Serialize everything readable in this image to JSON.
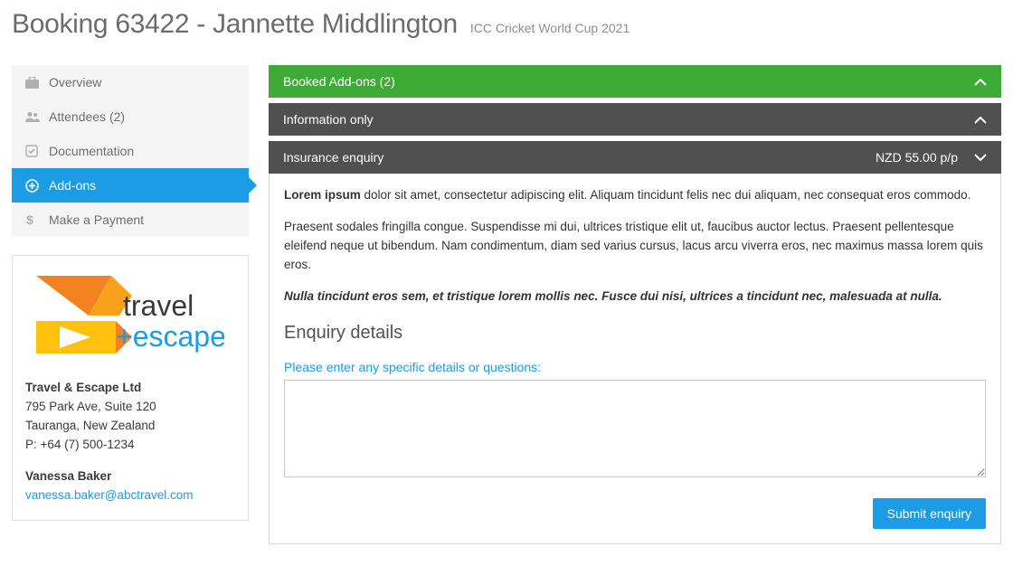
{
  "header": {
    "title": "Booking 63422 - Jannette Middlington",
    "subtitle": "ICC Cricket World Cup 2021"
  },
  "nav": {
    "items": [
      {
        "label": "Overview"
      },
      {
        "label": "Attendees (2)"
      },
      {
        "label": "Documentation"
      },
      {
        "label": "Add-ons"
      },
      {
        "label": "Make a Payment"
      }
    ]
  },
  "contact": {
    "logo_line1": "travel",
    "logo_line2": "+escape",
    "company": "Travel & Escape Ltd",
    "addr1": "795 Park Ave, Suite 120",
    "addr2": "Tauranga, New Zealand",
    "phone": "P: +64 (7) 500-1234",
    "person": "Vanessa Baker",
    "email": "vanessa.baker@abctravel.com"
  },
  "panels": {
    "booked": {
      "title": "Booked Add-ons (2)"
    },
    "info": {
      "title": "Information only"
    },
    "insurance": {
      "title": "Insurance enquiry",
      "price": "NZD 55.00 p/p",
      "para1_lead": "Lorem ipsum",
      "para1_rest": " dolor sit amet, consectetur adipiscing elit. Aliquam tincidunt felis nec dui aliquam, nec consequat eros commodo.",
      "para2": "Praesent sodales fringilla congue. Suspendisse mi dui, ultrices tristique elit ut, faucibus auctor lectus. Praesent pellentesque eleifend neque ut bibendum. Nam condimentum, diam sed varius cursus, lacus arcu viverra eros, nec maximus massa lorem quis eros.",
      "para3": "Nulla tincidunt eros sem, et tristique lorem mollis nec. Fusce dui nisi, ultrices a tincidunt nec, malesuada at nulla.",
      "enquiry_heading": "Enquiry details",
      "field_label": "Please enter any specific details or questions:",
      "submit_label": "Submit enquiry"
    }
  }
}
